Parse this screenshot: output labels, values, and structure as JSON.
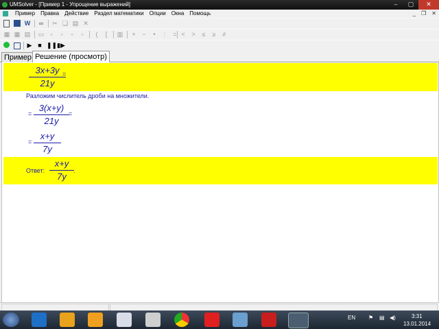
{
  "window": {
    "title": "UMSolver - [Пример 1 - Упрощение выражений]",
    "min": "–",
    "restore": "▢",
    "close": "✕"
  },
  "menu": {
    "items": [
      "Пример",
      "Правка",
      "Действие",
      "Раздел математики",
      "Опции",
      "Окна",
      "Помощь"
    ],
    "mdi": [
      "_",
      "❐",
      "✕"
    ]
  },
  "toolbar1": {
    "icons": [
      "new-doc-icon",
      "calculator-icon",
      "word-icon",
      "binoculars-icon",
      "cut-icon",
      "copy-icon",
      "paste-icon",
      "delete-icon"
    ]
  },
  "toolbar2": {
    "symbols": [
      "(",
      "[",
      "+",
      "−",
      "•",
      ":",
      "=",
      "<",
      ">",
      "≤",
      "≥",
      "≠"
    ]
  },
  "tabs": [
    {
      "label": "Пример"
    },
    {
      "label": "Решение (просмотр)"
    }
  ],
  "solution": {
    "step1": {
      "num": "3x+3y",
      "den": "21y",
      "eq": "="
    },
    "explanation": "Разложим числитель дроби на множители.",
    "step2": {
      "pre": "=",
      "num": "3(x+y)",
      "den": "21y",
      "eq": "="
    },
    "step3": {
      "pre": "=",
      "num": "x+y",
      "den": "7y"
    },
    "answer": {
      "label": "Ответ:",
      "num": "x+y",
      "den": "7y",
      "end": "."
    }
  },
  "taskbar": {
    "lang": "EN",
    "time": "3:31",
    "date": "13.01.2014"
  },
  "colors": {
    "highlight": "#ffff00",
    "math": "#1a1aa8"
  }
}
